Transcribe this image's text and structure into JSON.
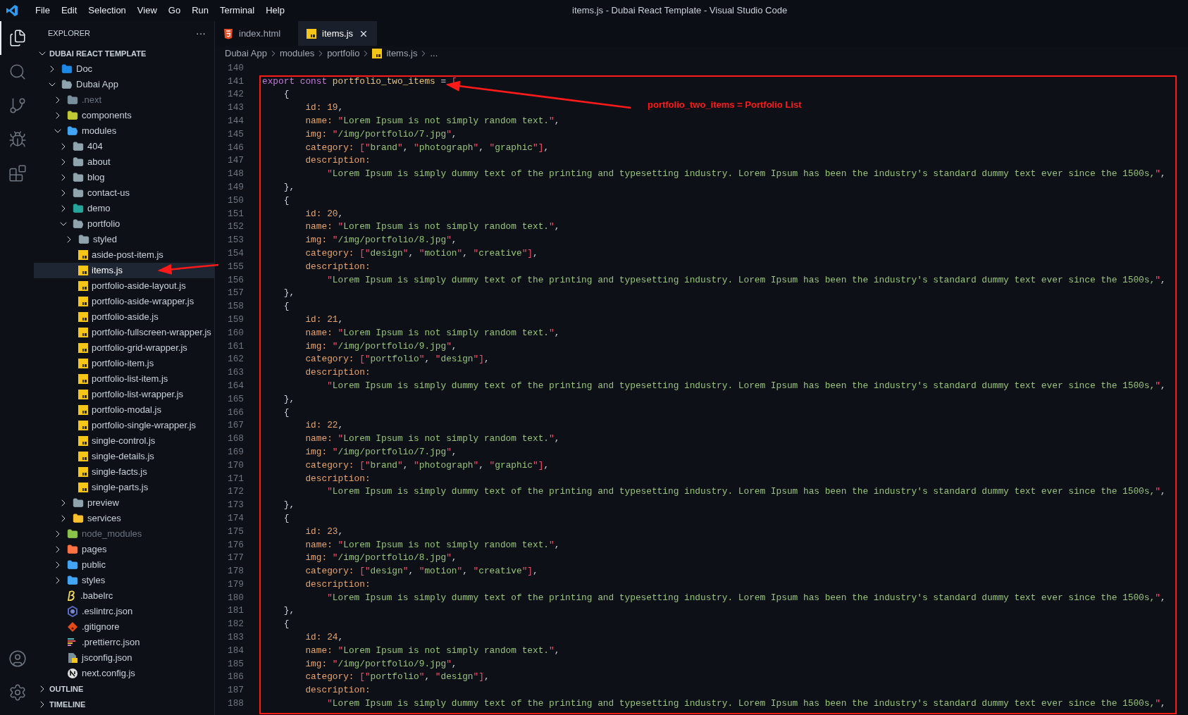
{
  "window": {
    "title": "items.js - Dubai React Template - Visual Studio Code"
  },
  "menu": [
    "File",
    "Edit",
    "Selection",
    "View",
    "Go",
    "Run",
    "Terminal",
    "Help"
  ],
  "activity_bar": {
    "top": [
      {
        "kind": "explorer",
        "selected": true
      },
      {
        "kind": "search",
        "selected": false
      },
      {
        "kind": "scm",
        "selected": false
      },
      {
        "kind": "debug",
        "selected": false
      },
      {
        "kind": "extensions",
        "selected": false
      }
    ],
    "bottom": [
      {
        "kind": "account",
        "selected": false
      },
      {
        "kind": "settings",
        "selected": false
      }
    ]
  },
  "sidebar": {
    "title": "EXPLORER",
    "more": "···",
    "root": "DUBAI REACT TEMPLATE",
    "tree": [
      {
        "name": "Doc",
        "kind": "docs",
        "expanded": false,
        "selected": false,
        "dimmed": false
      },
      {
        "name": "Dubai App",
        "kind": "folder",
        "expanded": true,
        "selected": false,
        "dimmed": false,
        "children": [
          {
            "name": ".next",
            "kind": "next",
            "expanded": false,
            "selected": false,
            "dimmed": true
          },
          {
            "name": "components",
            "kind": "components",
            "expanded": false,
            "selected": false,
            "dimmed": false
          },
          {
            "name": "modules",
            "kind": "modules",
            "expanded": true,
            "selected": false,
            "dimmed": false,
            "children": [
              {
                "name": "404",
                "kind": "folder",
                "expanded": false,
                "selected": false,
                "dimmed": false
              },
              {
                "name": "about",
                "kind": "folder",
                "expanded": false,
                "selected": false,
                "dimmed": false
              },
              {
                "name": "blog",
                "kind": "folder",
                "expanded": false,
                "selected": false,
                "dimmed": false
              },
              {
                "name": "contact-us",
                "kind": "folder",
                "expanded": false,
                "selected": false,
                "dimmed": false
              },
              {
                "name": "demo",
                "kind": "demo",
                "expanded": false,
                "selected": false,
                "dimmed": false
              },
              {
                "name": "portfolio",
                "kind": "folder",
                "expanded": true,
                "selected": false,
                "dimmed": false,
                "children": [
                  {
                    "name": "styled",
                    "kind": "folder",
                    "expanded": false,
                    "selected": false,
                    "dimmed": false
                  },
                  {
                    "name": "aside-post-item.js",
                    "kind": "js",
                    "selected": false,
                    "dimmed": false
                  },
                  {
                    "name": "items.js",
                    "kind": "js",
                    "selected": true,
                    "dimmed": false
                  },
                  {
                    "name": "portfolio-aside-layout.js",
                    "kind": "js",
                    "selected": false,
                    "dimmed": false
                  },
                  {
                    "name": "portfolio-aside-wrapper.js",
                    "kind": "js",
                    "selected": false,
                    "dimmed": false
                  },
                  {
                    "name": "portfolio-aside.js",
                    "kind": "js",
                    "selected": false,
                    "dimmed": false
                  },
                  {
                    "name": "portfolio-fullscreen-wrapper.js",
                    "kind": "js",
                    "selected": false,
                    "dimmed": false
                  },
                  {
                    "name": "portfolio-grid-wrapper.js",
                    "kind": "js",
                    "selected": false,
                    "dimmed": false
                  },
                  {
                    "name": "portfolio-item.js",
                    "kind": "js",
                    "selected": false,
                    "dimmed": false
                  },
                  {
                    "name": "portfolio-list-item.js",
                    "kind": "js",
                    "selected": false,
                    "dimmed": false
                  },
                  {
                    "name": "portfolio-list-wrapper.js",
                    "kind": "js",
                    "selected": false,
                    "dimmed": false
                  },
                  {
                    "name": "portfolio-modal.js",
                    "kind": "js",
                    "selected": false,
                    "dimmed": false
                  },
                  {
                    "name": "portfolio-single-wrapper.js",
                    "kind": "js",
                    "selected": false,
                    "dimmed": false
                  },
                  {
                    "name": "single-control.js",
                    "kind": "js",
                    "selected": false,
                    "dimmed": false
                  },
                  {
                    "name": "single-details.js",
                    "kind": "js",
                    "selected": false,
                    "dimmed": false
                  },
                  {
                    "name": "single-facts.js",
                    "kind": "js",
                    "selected": false,
                    "dimmed": false
                  },
                  {
                    "name": "single-parts.js",
                    "kind": "js",
                    "selected": false,
                    "dimmed": false
                  }
                ]
              },
              {
                "name": "preview",
                "kind": "folder",
                "expanded": false,
                "selected": false,
                "dimmed": false
              },
              {
                "name": "services",
                "kind": "services",
                "expanded": false,
                "selected": false,
                "dimmed": false
              }
            ]
          },
          {
            "name": "node_modules",
            "kind": "node",
            "expanded": false,
            "selected": false,
            "dimmed": true
          },
          {
            "name": "pages",
            "kind": "pages",
            "expanded": false,
            "selected": false,
            "dimmed": false
          },
          {
            "name": "public",
            "kind": "public",
            "expanded": false,
            "selected": false,
            "dimmed": false
          },
          {
            "name": "styles",
            "kind": "styles",
            "expanded": false,
            "selected": false,
            "dimmed": false
          },
          {
            "name": ".babelrc",
            "kind": "babel",
            "selected": false,
            "dimmed": false
          },
          {
            "name": ".eslintrc.json",
            "kind": "eslint",
            "selected": false,
            "dimmed": false
          },
          {
            "name": ".gitignore",
            "kind": "git",
            "selected": false,
            "dimmed": false
          },
          {
            "name": ".prettierrc.json",
            "kind": "prettier",
            "selected": false,
            "dimmed": false
          },
          {
            "name": "jsconfig.json",
            "kind": "jsconfig",
            "selected": false,
            "dimmed": false
          },
          {
            "name": "next.config.js",
            "kind": "nextjs",
            "selected": false,
            "dimmed": false
          }
        ]
      }
    ],
    "sections": [
      {
        "title": "OUTLINE",
        "expanded": false
      },
      {
        "title": "TIMELINE",
        "expanded": false
      }
    ]
  },
  "tabs": [
    {
      "label": "index.html",
      "kind": "html",
      "selected": false
    },
    {
      "label": "items.js",
      "kind": "js",
      "selected": true
    }
  ],
  "breadcrumb": [
    {
      "label": "Dubai App",
      "kind": "plain"
    },
    {
      "label": "modules",
      "kind": "plain"
    },
    {
      "label": "portfolio",
      "kind": "plain"
    },
    {
      "label": "items.js",
      "kind": "js"
    },
    {
      "label": "...",
      "kind": "plain"
    }
  ],
  "code": {
    "lines": [
      {
        "number": "140"
      },
      {
        "number": "141",
        "tokens": [
          {
            "kind": "kw",
            "text": "export const "
          },
          {
            "kind": "var",
            "text": "portfolio_two_items"
          },
          {
            "kind": "op",
            "text": " = "
          },
          {
            "kind": "br",
            "text": "["
          }
        ]
      },
      {
        "number": "142",
        "tokens": [
          {
            "kind": "punct",
            "text": "    {"
          }
        ]
      },
      {
        "number": "143",
        "tokens": [
          {
            "kind": "key",
            "text": "        id:"
          },
          {
            "kind": "num",
            "text": " 19"
          },
          {
            "kind": "punct",
            "text": ","
          }
        ]
      },
      {
        "number": "144",
        "tokens": [
          {
            "kind": "key",
            "text": "        name:"
          },
          {
            "kind": "str",
            "text": " \"Lorem Ipsum is not simply random text.\""
          },
          {
            "kind": "punct",
            "text": ","
          }
        ]
      },
      {
        "number": "145",
        "tokens": [
          {
            "kind": "key",
            "text": "        img:"
          },
          {
            "kind": "str",
            "text": " \"/img/portfolio/7.jpg\""
          },
          {
            "kind": "punct",
            "text": ","
          }
        ]
      },
      {
        "number": "146",
        "tokens": [
          {
            "kind": "key",
            "text": "        category:"
          },
          {
            "kind": "br",
            "text": " ["
          },
          {
            "kind": "str",
            "text": "\"brand\""
          },
          {
            "kind": "punct",
            "text": ", "
          },
          {
            "kind": "str",
            "text": "\"photograph\""
          },
          {
            "kind": "punct",
            "text": ", "
          },
          {
            "kind": "str",
            "text": "\"graphic\""
          },
          {
            "kind": "br",
            "text": "]"
          },
          {
            "kind": "punct",
            "text": ","
          }
        ]
      },
      {
        "number": "147",
        "tokens": [
          {
            "kind": "key",
            "text": "        description:"
          }
        ]
      },
      {
        "number": "148",
        "tokens": [
          {
            "kind": "str",
            "text": "            \"Lorem Ipsum is simply dummy text of the printing and typesetting industry. Lorem Ipsum has been the industry's standard dummy text ever since the 1500s,\""
          },
          {
            "kind": "punct",
            "text": ","
          }
        ]
      },
      {
        "number": "149",
        "tokens": [
          {
            "kind": "punct",
            "text": "    },"
          }
        ]
      },
      {
        "number": "150",
        "tokens": [
          {
            "kind": "punct",
            "text": "    {"
          }
        ]
      },
      {
        "number": "151",
        "tokens": [
          {
            "kind": "key",
            "text": "        id:"
          },
          {
            "kind": "num",
            "text": " 20"
          },
          {
            "kind": "punct",
            "text": ","
          }
        ]
      },
      {
        "number": "152",
        "tokens": [
          {
            "kind": "key",
            "text": "        name:"
          },
          {
            "kind": "str",
            "text": " \"Lorem Ipsum is not simply random text.\""
          },
          {
            "kind": "punct",
            "text": ","
          }
        ]
      },
      {
        "number": "153",
        "tokens": [
          {
            "kind": "key",
            "text": "        img:"
          },
          {
            "kind": "str",
            "text": " \"/img/portfolio/8.jpg\""
          },
          {
            "kind": "punct",
            "text": ","
          }
        ]
      },
      {
        "number": "154",
        "tokens": [
          {
            "kind": "key",
            "text": "        category:"
          },
          {
            "kind": "br",
            "text": " ["
          },
          {
            "kind": "str",
            "text": "\"design\""
          },
          {
            "kind": "punct",
            "text": ", "
          },
          {
            "kind": "str",
            "text": "\"motion\""
          },
          {
            "kind": "punct",
            "text": ", "
          },
          {
            "kind": "str",
            "text": "\"creative\""
          },
          {
            "kind": "br",
            "text": "]"
          },
          {
            "kind": "punct",
            "text": ","
          }
        ]
      },
      {
        "number": "155",
        "tokens": [
          {
            "kind": "key",
            "text": "        description:"
          }
        ]
      },
      {
        "number": "156",
        "tokens": [
          {
            "kind": "str",
            "text": "            \"Lorem Ipsum is simply dummy text of the printing and typesetting industry. Lorem Ipsum has been the industry's standard dummy text ever since the 1500s,\""
          },
          {
            "kind": "punct",
            "text": ","
          }
        ]
      },
      {
        "number": "157",
        "tokens": [
          {
            "kind": "punct",
            "text": "    },"
          }
        ]
      },
      {
        "number": "158",
        "tokens": [
          {
            "kind": "punct",
            "text": "    {"
          }
        ]
      },
      {
        "number": "159",
        "tokens": [
          {
            "kind": "key",
            "text": "        id:"
          },
          {
            "kind": "num",
            "text": " 21"
          },
          {
            "kind": "punct",
            "text": ","
          }
        ]
      },
      {
        "number": "160",
        "tokens": [
          {
            "kind": "key",
            "text": "        name:"
          },
          {
            "kind": "str",
            "text": " \"Lorem Ipsum is not simply random text.\""
          },
          {
            "kind": "punct",
            "text": ","
          }
        ]
      },
      {
        "number": "161",
        "tokens": [
          {
            "kind": "key",
            "text": "        img:"
          },
          {
            "kind": "str",
            "text": " \"/img/portfolio/9.jpg\""
          },
          {
            "kind": "punct",
            "text": ","
          }
        ]
      },
      {
        "number": "162",
        "tokens": [
          {
            "kind": "key",
            "text": "        category:"
          },
          {
            "kind": "br",
            "text": " ["
          },
          {
            "kind": "str",
            "text": "\"portfolio\""
          },
          {
            "kind": "punct",
            "text": ", "
          },
          {
            "kind": "str",
            "text": "\"design\""
          },
          {
            "kind": "br",
            "text": "]"
          },
          {
            "kind": "punct",
            "text": ","
          }
        ]
      },
      {
        "number": "163",
        "tokens": [
          {
            "kind": "key",
            "text": "        description:"
          }
        ]
      },
      {
        "number": "164",
        "tokens": [
          {
            "kind": "str",
            "text": "            \"Lorem Ipsum is simply dummy text of the printing and typesetting industry. Lorem Ipsum has been the industry's standard dummy text ever since the 1500s,\""
          },
          {
            "kind": "punct",
            "text": ","
          }
        ]
      },
      {
        "number": "165",
        "tokens": [
          {
            "kind": "punct",
            "text": "    },"
          }
        ]
      },
      {
        "number": "166",
        "tokens": [
          {
            "kind": "punct",
            "text": "    {"
          }
        ]
      },
      {
        "number": "167",
        "tokens": [
          {
            "kind": "key",
            "text": "        id:"
          },
          {
            "kind": "num",
            "text": " 22"
          },
          {
            "kind": "punct",
            "text": ","
          }
        ]
      },
      {
        "number": "168",
        "tokens": [
          {
            "kind": "key",
            "text": "        name:"
          },
          {
            "kind": "str",
            "text": " \"Lorem Ipsum is not simply random text.\""
          },
          {
            "kind": "punct",
            "text": ","
          }
        ]
      },
      {
        "number": "169",
        "tokens": [
          {
            "kind": "key",
            "text": "        img:"
          },
          {
            "kind": "str",
            "text": " \"/img/portfolio/7.jpg\""
          },
          {
            "kind": "punct",
            "text": ","
          }
        ]
      },
      {
        "number": "170",
        "tokens": [
          {
            "kind": "key",
            "text": "        category:"
          },
          {
            "kind": "br",
            "text": " ["
          },
          {
            "kind": "str",
            "text": "\"brand\""
          },
          {
            "kind": "punct",
            "text": ", "
          },
          {
            "kind": "str",
            "text": "\"photograph\""
          },
          {
            "kind": "punct",
            "text": ", "
          },
          {
            "kind": "str",
            "text": "\"graphic\""
          },
          {
            "kind": "br",
            "text": "]"
          },
          {
            "kind": "punct",
            "text": ","
          }
        ]
      },
      {
        "number": "171",
        "tokens": [
          {
            "kind": "key",
            "text": "        description:"
          }
        ]
      },
      {
        "number": "172",
        "tokens": [
          {
            "kind": "str",
            "text": "            \"Lorem Ipsum is simply dummy text of the printing and typesetting industry. Lorem Ipsum has been the industry's standard dummy text ever since the 1500s,\""
          },
          {
            "kind": "punct",
            "text": ","
          }
        ]
      },
      {
        "number": "173",
        "tokens": [
          {
            "kind": "punct",
            "text": "    },"
          }
        ]
      },
      {
        "number": "174",
        "tokens": [
          {
            "kind": "punct",
            "text": "    {"
          }
        ]
      },
      {
        "number": "175",
        "tokens": [
          {
            "kind": "key",
            "text": "        id:"
          },
          {
            "kind": "num",
            "text": " 23"
          },
          {
            "kind": "punct",
            "text": ","
          }
        ]
      },
      {
        "number": "176",
        "tokens": [
          {
            "kind": "key",
            "text": "        name:"
          },
          {
            "kind": "str",
            "text": " \"Lorem Ipsum is not simply random text.\""
          },
          {
            "kind": "punct",
            "text": ","
          }
        ]
      },
      {
        "number": "177",
        "tokens": [
          {
            "kind": "key",
            "text": "        img:"
          },
          {
            "kind": "str",
            "text": " \"/img/portfolio/8.jpg\""
          },
          {
            "kind": "punct",
            "text": ","
          }
        ]
      },
      {
        "number": "178",
        "tokens": [
          {
            "kind": "key",
            "text": "        category:"
          },
          {
            "kind": "br",
            "text": " ["
          },
          {
            "kind": "str",
            "text": "\"design\""
          },
          {
            "kind": "punct",
            "text": ", "
          },
          {
            "kind": "str",
            "text": "\"motion\""
          },
          {
            "kind": "punct",
            "text": ", "
          },
          {
            "kind": "str",
            "text": "\"creative\""
          },
          {
            "kind": "br",
            "text": "]"
          },
          {
            "kind": "punct",
            "text": ","
          }
        ]
      },
      {
        "number": "179",
        "tokens": [
          {
            "kind": "key",
            "text": "        description:"
          }
        ]
      },
      {
        "number": "180",
        "tokens": [
          {
            "kind": "str",
            "text": "            \"Lorem Ipsum is simply dummy text of the printing and typesetting industry. Lorem Ipsum has been the industry's standard dummy text ever since the 1500s,\""
          },
          {
            "kind": "punct",
            "text": ","
          }
        ]
      },
      {
        "number": "181",
        "tokens": [
          {
            "kind": "punct",
            "text": "    },"
          }
        ]
      },
      {
        "number": "182",
        "tokens": [
          {
            "kind": "punct",
            "text": "    {"
          }
        ]
      },
      {
        "number": "183",
        "tokens": [
          {
            "kind": "key",
            "text": "        id:"
          },
          {
            "kind": "num",
            "text": " 24"
          },
          {
            "kind": "punct",
            "text": ","
          }
        ]
      },
      {
        "number": "184",
        "tokens": [
          {
            "kind": "key",
            "text": "        name:"
          },
          {
            "kind": "str",
            "text": " \"Lorem Ipsum is not simply random text.\""
          },
          {
            "kind": "punct",
            "text": ","
          }
        ]
      },
      {
        "number": "185",
        "tokens": [
          {
            "kind": "key",
            "text": "        img:"
          },
          {
            "kind": "str",
            "text": " \"/img/portfolio/9.jpg\""
          },
          {
            "kind": "punct",
            "text": ","
          }
        ]
      },
      {
        "number": "186",
        "tokens": [
          {
            "kind": "key",
            "text": "        category:"
          },
          {
            "kind": "br",
            "text": " ["
          },
          {
            "kind": "str",
            "text": "\"portfolio\""
          },
          {
            "kind": "punct",
            "text": ", "
          },
          {
            "kind": "str",
            "text": "\"design\""
          },
          {
            "kind": "br",
            "text": "]"
          },
          {
            "kind": "punct",
            "text": ","
          }
        ]
      },
      {
        "number": "187",
        "tokens": [
          {
            "kind": "key",
            "text": "        description:"
          }
        ]
      },
      {
        "number": "188",
        "tokens": [
          {
            "kind": "str",
            "text": "            \"Lorem Ipsum is simply dummy text of the printing and typesetting industry. Lorem Ipsum has been the industry's standard dummy text ever since the 1500s,\""
          },
          {
            "kind": "punct",
            "text": ","
          }
        ]
      }
    ]
  },
  "annotation": {
    "label": "portfolio_two_items = Portfolio List"
  }
}
